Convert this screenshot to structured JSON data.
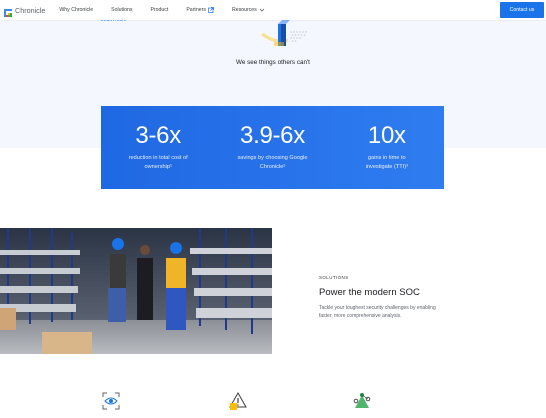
{
  "header": {
    "logo_text": "Chronicle",
    "nav": [
      {
        "label": "Why Chronicle"
      },
      {
        "label": "Solutions"
      },
      {
        "label": "Product"
      },
      {
        "label": "Partners"
      },
      {
        "label": "Resources"
      }
    ],
    "contact_label": "Contact us"
  },
  "top": {
    "learn_more": "Learn more",
    "tagline": "We see things others can't"
  },
  "stats": [
    {
      "value": "3-6x",
      "desc_line1": "reduction in total cost of",
      "desc_line2": "ownership¹"
    },
    {
      "value": "3.9-6x",
      "desc_line1": "savings by choosing Google",
      "desc_line2": "Chronicle²"
    },
    {
      "value": "10x",
      "desc_line1": "gains in time to",
      "desc_line2": "investigate (TTI)³"
    }
  ],
  "solutions": {
    "kicker": "SOLUTIONS",
    "title": "Power the modern SOC",
    "description": "Tackle your toughest security challenges by enabling faster, more comprehensive analysis."
  },
  "colors": {
    "brand_blue": "#1a73e8",
    "stats_band": "#2a74ec",
    "top_band": "#f4f7fd"
  },
  "icons": [
    "eye-scan-icon",
    "warning-triangle-icon",
    "network-nodes-icon"
  ]
}
